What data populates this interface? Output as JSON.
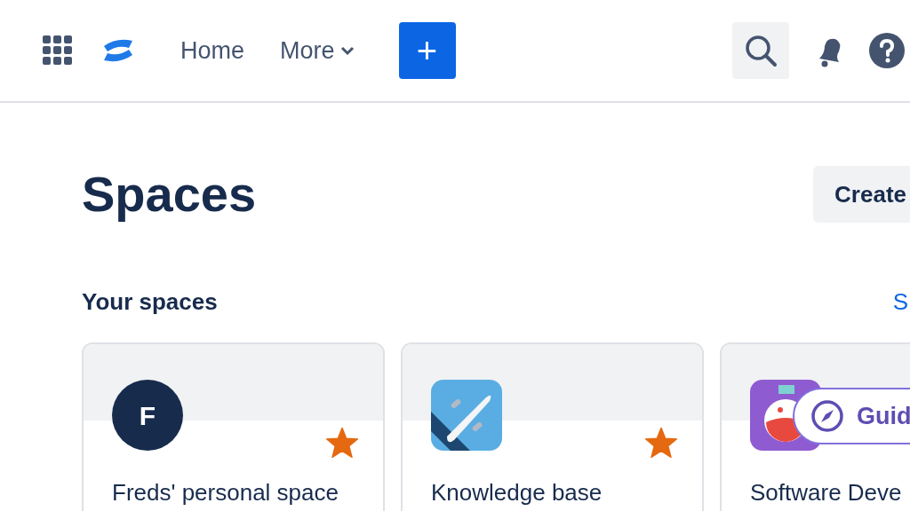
{
  "nav": {
    "items": [
      {
        "label": "Home",
        "dropdown": false
      },
      {
        "label": "More",
        "dropdown": true
      }
    ],
    "create_icon": "+"
  },
  "page": {
    "title": "Spaces",
    "create_button": "Create"
  },
  "section": {
    "title": "Your spaces",
    "link": "S"
  },
  "spaces": [
    {
      "name": "Freds' personal space",
      "kind": "letter",
      "letter": "F",
      "starred": true
    },
    {
      "name": "Knowledge base",
      "kind": "airplane",
      "starred": true
    },
    {
      "name": "Software Deve",
      "kind": "flask"
    }
  ],
  "guide_button": {
    "label": "Guid"
  }
}
